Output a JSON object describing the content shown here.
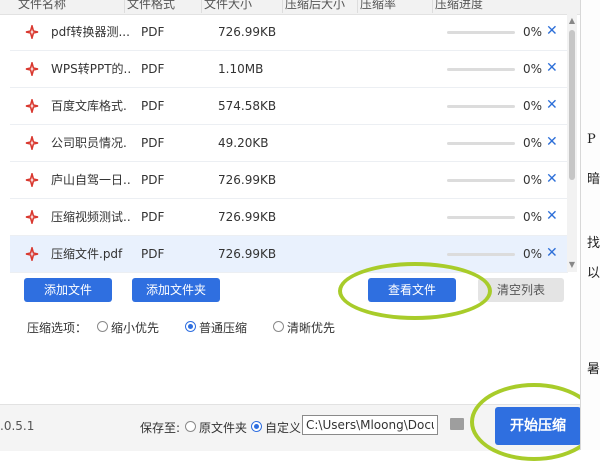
{
  "table": {
    "columns": [
      "文件名称",
      "文件格式",
      "文件大小",
      "压缩后大小",
      "压缩率",
      "压缩进度"
    ],
    "rows": [
      {
        "name": "pdf转换器测...",
        "format": "PDF",
        "size": "726.99KB",
        "percent": "0%",
        "progress": 0
      },
      {
        "name": "WPS转PPT的...",
        "format": "PDF",
        "size": "1.10MB",
        "percent": "0%",
        "progress": 0
      },
      {
        "name": "百度文库格式.",
        "format": "PDF",
        "size": "574.58KB",
        "percent": "0%",
        "progress": 0
      },
      {
        "name": "公司职员情况.",
        "format": "PDF",
        "size": "49.20KB",
        "percent": "0%",
        "progress": 0
      },
      {
        "name": "庐山自驾一日...",
        "format": "PDF",
        "size": "726.99KB",
        "percent": "0%",
        "progress": 0
      },
      {
        "name": "压缩视频测试...",
        "format": "PDF",
        "size": "726.99KB",
        "percent": "0%",
        "progress": 0
      },
      {
        "name": "压缩文件.pdf",
        "format": "PDF",
        "size": "726.99KB",
        "percent": "0%",
        "progress": 0
      }
    ]
  },
  "actions": {
    "add_file": "添加文件",
    "add_folder": "添加文件夹",
    "view_file": "查看文件",
    "clear_list": "清空列表"
  },
  "options": {
    "label": "压缩选项：",
    "items": [
      {
        "label": "缩小优先",
        "selected": false
      },
      {
        "label": "普通压缩",
        "selected": true
      },
      {
        "label": "清晰优先",
        "selected": false
      }
    ]
  },
  "footer": {
    "version": ".0.5.1",
    "save_to": "保存至:",
    "original_folder": "原文件夹",
    "custom": "自定义",
    "path": "C:\\Users\\Mloong\\Documents",
    "start": "开始压缩"
  },
  "side_doc": [
    "P",
    "暗",
    "找",
    "以",
    "暑"
  ],
  "colors": {
    "accent": "#2f6fe0",
    "highlight_ring": "#a8cc2a",
    "pdf_icon": "#d9382f"
  }
}
